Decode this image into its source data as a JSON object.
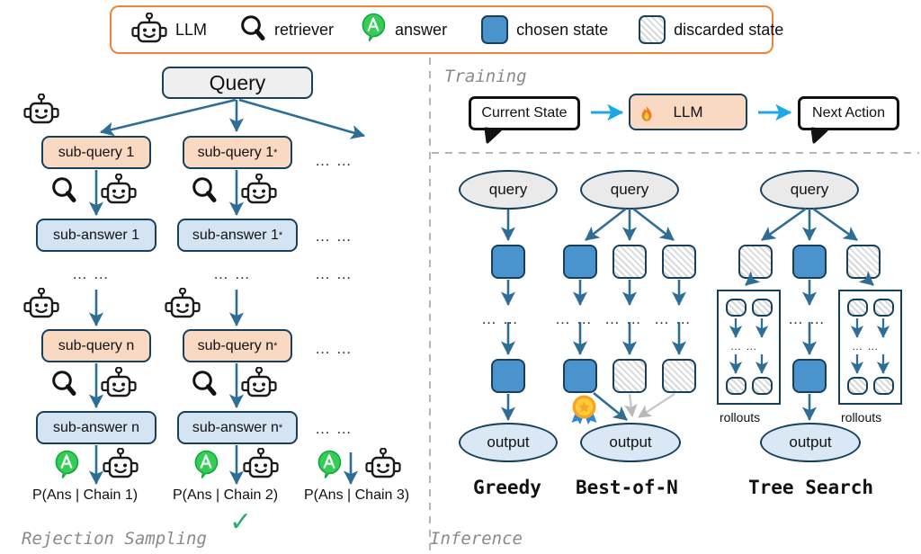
{
  "legend": {
    "items": [
      {
        "icon": "robot-icon",
        "label": "LLM"
      },
      {
        "icon": "magnifier-icon",
        "label": "retriever"
      },
      {
        "icon": "answer-bubble-icon",
        "label": "answer"
      },
      {
        "icon": "chosen-state-swatch",
        "label": "chosen state"
      },
      {
        "icon": "discarded-state-swatch",
        "label": "discarded state"
      }
    ],
    "border_color": "#F08336"
  },
  "left_panel": {
    "caption": "Rejection Sampling",
    "root": "Query",
    "checkmark": "✓",
    "ellipsis": "… …",
    "chains": [
      {
        "sub_query": "sub-query 1",
        "sub_query_n": "sub-query n",
        "sub_answer": "sub-answer 1",
        "sub_answer_n": "sub-answer n",
        "probability": "P(Ans | Chain 1)",
        "selected": false
      },
      {
        "sub_query": "sub-query 1",
        "sub_query_star": "*",
        "sub_query_n": "sub-query n",
        "sub_answer": "sub-answer 1",
        "sub_answer_n": "sub-answer n",
        "probability": "P(Ans | Chain 2)",
        "selected": true
      },
      {
        "probability": "P(Ans | Chain 3)",
        "selected": false
      }
    ]
  },
  "training": {
    "caption": "Training",
    "input_label": "Current State",
    "model_label": "LLM",
    "model_icon": "flame-icon",
    "output_label": "Next Action",
    "arrow_color": "#1CA8E8"
  },
  "inference": {
    "caption": "Inference",
    "columns": [
      {
        "name": "Greedy",
        "query_label": "query",
        "output_label": "output",
        "ellipsis": "… …",
        "states_top": [
          "chosen"
        ],
        "states_bottom": [
          "chosen"
        ]
      },
      {
        "name": "Best-of-N",
        "query_label": "query",
        "output_label": "output",
        "ellipsis": "… …",
        "states_top": [
          "chosen",
          "discarded",
          "discarded"
        ],
        "states_bottom": [
          "chosen",
          "discarded",
          "discarded"
        ],
        "badge_icon": "medal-icon"
      },
      {
        "name": "Tree Search",
        "query_label": "query",
        "output_label": "output",
        "ellipsis": "… …",
        "states_top": [
          "discarded",
          "chosen",
          "discarded"
        ],
        "states_bottom": [
          "chosen"
        ],
        "rollout_label_left": "rollouts",
        "rollout_label_right": "rollouts"
      }
    ]
  },
  "colors": {
    "accent_orange": "#F08336",
    "chosen_blue": "#4B93CC",
    "node_border": "#17405C",
    "arrow_blue": "#2E6E96",
    "training_arrow": "#1CA8E8",
    "sub_query_fill": "#FAD9C3",
    "sub_answer_fill": "#D4E4F2",
    "check_green": "#27AE76"
  }
}
